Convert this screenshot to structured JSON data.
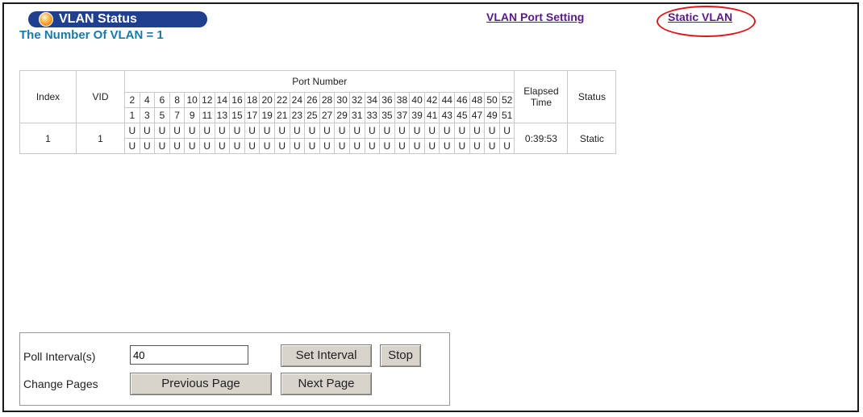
{
  "header": {
    "title": "VLAN Status",
    "vlan_count_text": "The Number Of VLAN = 1"
  },
  "links": {
    "port_setting": "VLAN Port Setting",
    "static_vlan": "Static VLAN"
  },
  "table": {
    "col_index": "Index",
    "col_vid": "VID",
    "col_port_number": "Port Number",
    "col_elapsed": "Elapsed Time",
    "col_status": "Status",
    "even_ports": [
      "2",
      "4",
      "6",
      "8",
      "10",
      "12",
      "14",
      "16",
      "18",
      "20",
      "22",
      "24",
      "26",
      "28",
      "30",
      "32",
      "34",
      "36",
      "38",
      "40",
      "42",
      "44",
      "46",
      "48",
      "50",
      "52"
    ],
    "odd_ports": [
      "1",
      "3",
      "5",
      "7",
      "9",
      "11",
      "13",
      "15",
      "17",
      "19",
      "21",
      "23",
      "25",
      "27",
      "29",
      "31",
      "33",
      "35",
      "37",
      "39",
      "41",
      "43",
      "45",
      "47",
      "49",
      "51"
    ],
    "rows": [
      {
        "index": "1",
        "vid": "1",
        "even_values": [
          "U",
          "U",
          "U",
          "U",
          "U",
          "U",
          "U",
          "U",
          "U",
          "U",
          "U",
          "U",
          "U",
          "U",
          "U",
          "U",
          "U",
          "U",
          "U",
          "U",
          "U",
          "U",
          "U",
          "U",
          "U",
          "U"
        ],
        "odd_values": [
          "U",
          "U",
          "U",
          "U",
          "U",
          "U",
          "U",
          "U",
          "U",
          "U",
          "U",
          "U",
          "U",
          "U",
          "U",
          "U",
          "U",
          "U",
          "U",
          "U",
          "U",
          "U",
          "U",
          "U",
          "U",
          "U"
        ],
        "elapsed": "0:39:53",
        "status": "Static"
      }
    ]
  },
  "controls": {
    "poll_label": "Poll Interval(s)",
    "poll_value": "40",
    "set_interval": "Set Interval",
    "stop": "Stop",
    "change_pages_label": "Change Pages",
    "previous_page": "Previous Page",
    "next_page": "Next Page"
  },
  "colors": {
    "title_pill": "#1f3f8f",
    "link": "#5a1a86",
    "highlight_ring": "#e0161b",
    "count_text": "#1a79a8"
  }
}
